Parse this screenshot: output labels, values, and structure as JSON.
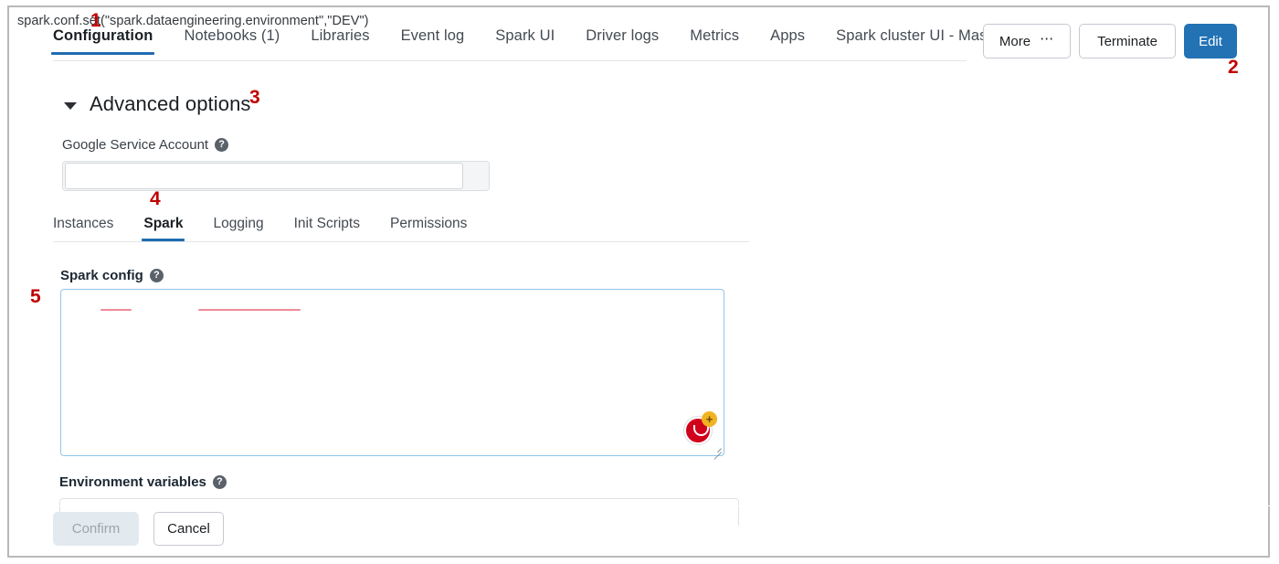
{
  "header": {
    "tabs": [
      {
        "label": "Configuration",
        "active": true
      },
      {
        "label": "Notebooks (1)",
        "active": false
      },
      {
        "label": "Libraries",
        "active": false
      },
      {
        "label": "Event log",
        "active": false
      },
      {
        "label": "Spark UI",
        "active": false
      },
      {
        "label": "Driver logs",
        "active": false
      },
      {
        "label": "Metrics",
        "active": false
      },
      {
        "label": "Apps",
        "active": false
      },
      {
        "label": "Spark cluster UI - Master",
        "active": false
      }
    ],
    "actions": {
      "more_label": "More",
      "more_icon": "ellipsis-icon",
      "terminate_label": "Terminate",
      "edit_label": "Edit"
    }
  },
  "annotations": [
    {
      "id": "1",
      "text": "1"
    },
    {
      "id": "2",
      "text": "2"
    },
    {
      "id": "3",
      "text": "3"
    },
    {
      "id": "4",
      "text": "4"
    },
    {
      "id": "5",
      "text": "5"
    }
  ],
  "advanced_options": {
    "label": "Advanced options",
    "caret_icon": "caret-down-icon",
    "expanded": true
  },
  "google_service_account": {
    "label": "Google Service Account",
    "help_icon": "help-circle-icon",
    "value": "",
    "placeholder": ""
  },
  "sub_tabs": [
    {
      "label": "Instances",
      "active": false
    },
    {
      "label": "Spark",
      "active": true
    },
    {
      "label": "Logging",
      "active": false
    },
    {
      "label": "Init Scripts",
      "active": false
    },
    {
      "label": "Permissions",
      "active": false
    }
  ],
  "spark_config": {
    "label": "Spark config",
    "help_icon": "help-circle-icon",
    "value": "spark.conf.set(\"spark.dataengineering.environment\",\"DEV\")",
    "spellcheck_words": [
      "conf",
      "dataengineering"
    ],
    "grammarly_icon": "grammarly-icon",
    "grammarly_badge": "+",
    "resize_handle_icon": "resize-handle-icon"
  },
  "environment_variables": {
    "label": "Environment variables",
    "help_icon": "help-circle-icon",
    "value": ""
  },
  "footer": {
    "confirm_label": "Confirm",
    "confirm_disabled": true,
    "cancel_label": "Cancel"
  },
  "colors": {
    "accent_blue": "#2272b4",
    "tab_underline": "#1f6cb0",
    "annotation_red": "#c00000",
    "grammarly_red": "#d0011b",
    "grammarly_badge_yellow": "#f0b323",
    "spellcheck_underline": "#ef8a9a",
    "focus_border": "#8fc5ea"
  }
}
